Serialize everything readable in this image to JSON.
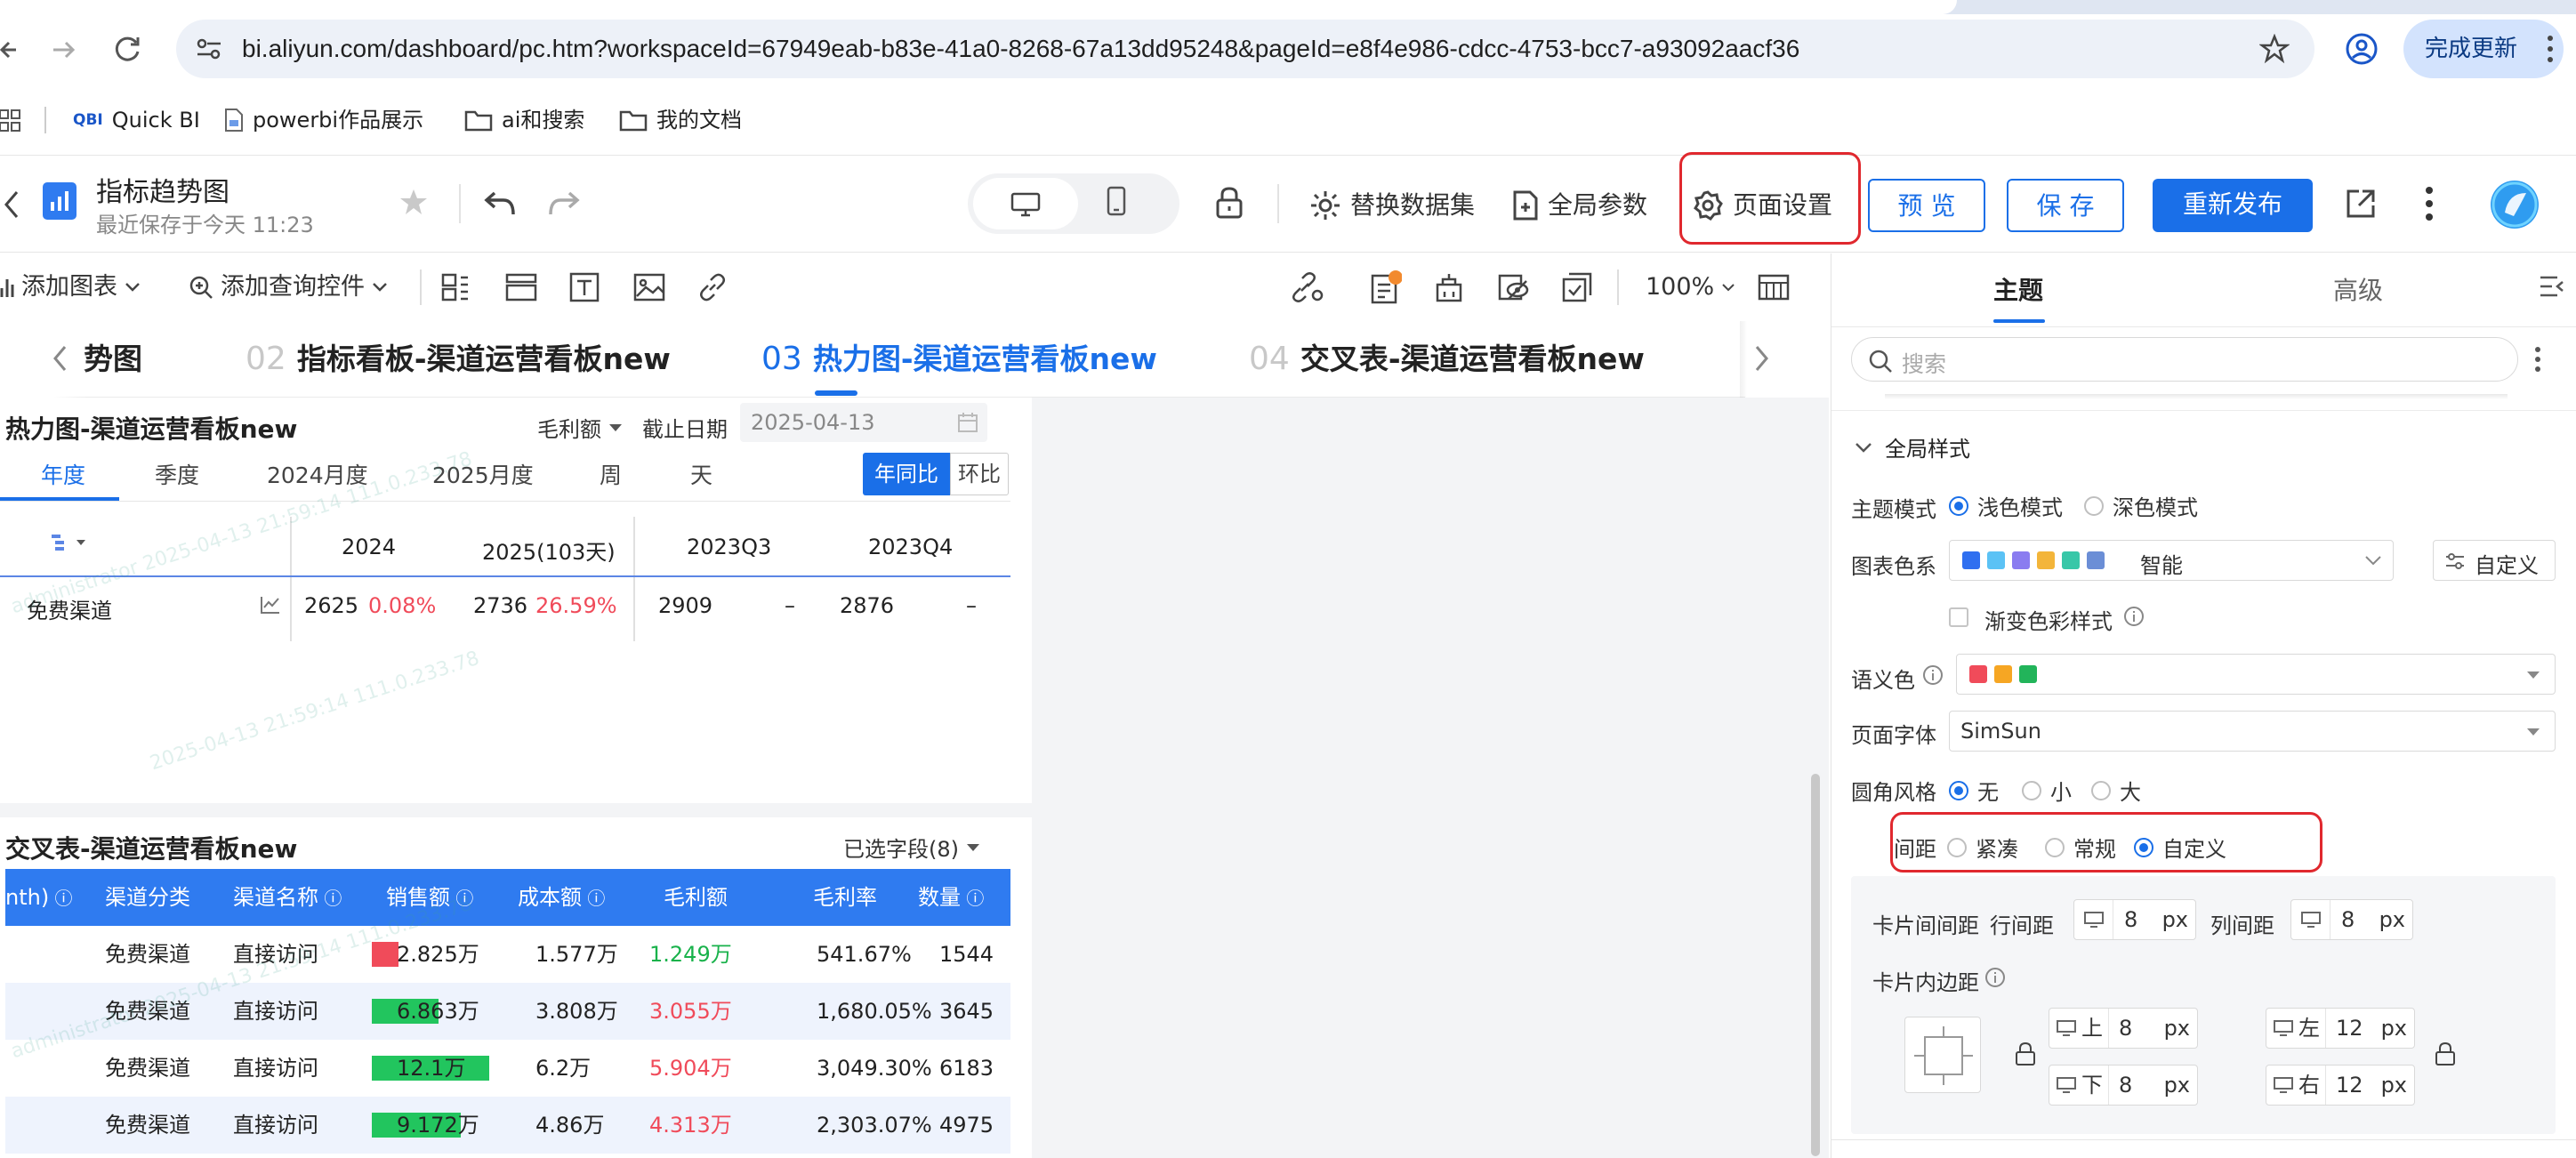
{
  "browser": {
    "url": "bi.aliyun.com/dashboard/pc.htm?workspaceId=67949eab-b83e-41a0-8268-67a13dd95248&pageId=e8f4e986-cdcc-4753-bcc7-a93092aacf36",
    "update_label": "完成更新",
    "bookmarks": [
      "Quick BI",
      "powerbi作品展示",
      "ai和搜索",
      "我的文档"
    ],
    "quickbi_badge": "QBI"
  },
  "app": {
    "title": "指标趋势图",
    "saved": "最近保存于今天 11:23",
    "replace_dataset": "替换数据集",
    "global_params": "全局参数",
    "page_settings": "页面设置",
    "preview": "预 览",
    "save": "保 存",
    "republish": "重新发布"
  },
  "toolbar": {
    "add_chart": "添加图表",
    "add_query": "添加查询控件",
    "zoom": "100%"
  },
  "page_tabs": [
    {
      "num": "",
      "label": "势图"
    },
    {
      "num": "02",
      "label": "指标看板-渠道运营看板new"
    },
    {
      "num": "03",
      "label": "热力图-渠道运营看板new"
    },
    {
      "num": "04",
      "label": "交叉表-渠道运营看板new"
    }
  ],
  "heat_card": {
    "title": "热力图-渠道运营看板new",
    "measure": "毛利额",
    "date_label": "截止日期",
    "date_value": "2025-04-13",
    "tabs": [
      "年度",
      "季度",
      "2024月度",
      "2025月度",
      "周",
      "天"
    ],
    "compare": [
      "年同比",
      "环比"
    ],
    "columns": [
      "2024",
      "2025(103天)",
      "2023Q3",
      "2023Q4"
    ],
    "row": {
      "name": "免费渠道",
      "cells": [
        {
          "value": "2625",
          "pct": "0.08%"
        },
        {
          "value": "2736",
          "pct": "26.59%"
        },
        {
          "value": "2909",
          "pct": "–"
        },
        {
          "value": "2876",
          "pct": "–"
        }
      ]
    }
  },
  "cross_card": {
    "title": "交叉表-渠道运营看板new",
    "selected": "已选字段(8)",
    "headers": [
      "nth)",
      "渠道分类",
      "渠道名称",
      "销售额",
      "成本额",
      "毛利额",
      "毛利率",
      "数量"
    ],
    "rows": [
      {
        "cat": "免费渠道",
        "name": "直接访问",
        "sales": "2.825万",
        "sales_fill": 0.23,
        "sales_color": "#f04b5a",
        "cost": "1.577万",
        "profit": "1.249万",
        "profit_color": "#19b24b",
        "rate": "541.67%",
        "qty": "1544"
      },
      {
        "cat": "免费渠道",
        "name": "直接访问",
        "sales": "6.863万",
        "sales_fill": 0.57,
        "sales_color": "#22c55e",
        "cost": "3.808万",
        "profit": "3.055万",
        "profit_color": "#f04b5a",
        "rate": "1,680.05%",
        "qty": "3645"
      },
      {
        "cat": "免费渠道",
        "name": "直接访问",
        "sales": "12.1万",
        "sales_fill": 1.0,
        "sales_color": "#22c55e",
        "cost": "6.2万",
        "profit": "5.904万",
        "profit_color": "#f04b5a",
        "rate": "3,049.30%",
        "qty": "6183"
      },
      {
        "cat": "免费渠道",
        "name": "直接访问",
        "sales": "9.172万",
        "sales_fill": 0.76,
        "sales_color": "#22c55e",
        "cost": "4.86万",
        "profit": "4.313万",
        "profit_color": "#f04b5a",
        "rate": "2,303.07%",
        "qty": "4975"
      }
    ]
  },
  "panel": {
    "tabs": [
      "主题",
      "高级"
    ],
    "search_placeholder": "搜索",
    "section": "全局样式",
    "theme_mode_label": "主题模式",
    "theme_modes": [
      "浅色模式",
      "深色模式"
    ],
    "palette_label": "图表色系",
    "palette_value": "智能",
    "palette_colors": [
      "#2f6ff0",
      "#5bc2f5",
      "#8a7cf0",
      "#f3b53a",
      "#38c7a8",
      "#6b8ed6"
    ],
    "custom_label": "自定义",
    "gradient_label": "渐变色彩样式",
    "semantic_label": "语义色",
    "semantic_colors": [
      "#f04b5a",
      "#f6a623",
      "#22b45a"
    ],
    "font_label": "页面字体",
    "font_value": "SimSun",
    "corner_label": "圆角风格",
    "corner_options": [
      "无",
      "小",
      "大"
    ],
    "spacing_label": "间距",
    "spacing_options": [
      "紧凑",
      "常规",
      "自定义"
    ],
    "card_gap_label": "卡片间间距",
    "row_gap_label": "行间距",
    "row_gap": "8",
    "col_gap_label": "列间距",
    "col_gap": "8",
    "unit": "px",
    "padding_label": "卡片内边距",
    "pad_top_label": "上",
    "pad_top": "8",
    "pad_bottom_label": "下",
    "pad_bottom": "8",
    "pad_left_label": "左",
    "pad_left": "12",
    "pad_right_label": "右",
    "pad_right": "12"
  }
}
